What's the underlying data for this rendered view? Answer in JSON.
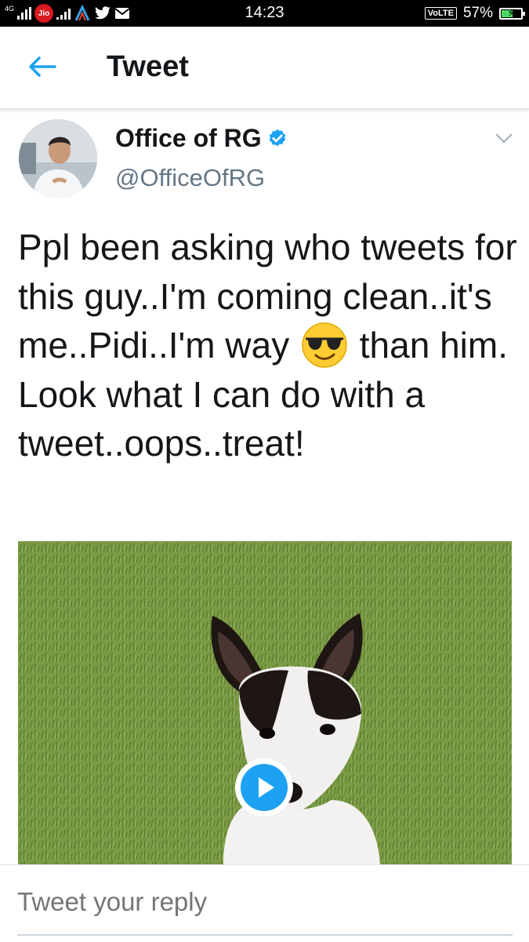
{
  "status_bar": {
    "network_type": "4G",
    "carrier": "Jio",
    "time": "14:23",
    "volte": "VoLTE",
    "battery_percent": "57%",
    "battery_level": 0.57
  },
  "app_bar": {
    "title": "Tweet"
  },
  "tweet": {
    "display_name": "Office of RG",
    "handle": "@OfficeOfRG",
    "verified": true,
    "text_before_emoji": "Ppl been asking who tweets for this guy..I'm coming clean..it's me..Pidi..I'm way",
    "text_after_emoji": "than him.  Look what I can do with a tweet..oops..treat!",
    "emoji": "smiling-face-with-sunglasses",
    "media": {
      "type": "video",
      "subject": "dog-on-grass"
    }
  },
  "reply": {
    "placeholder": "Tweet your reply"
  },
  "colors": {
    "accent": "#1da1f2",
    "text_primary": "#14171a",
    "text_secondary": "#657786",
    "jio_red": "#d71920"
  }
}
